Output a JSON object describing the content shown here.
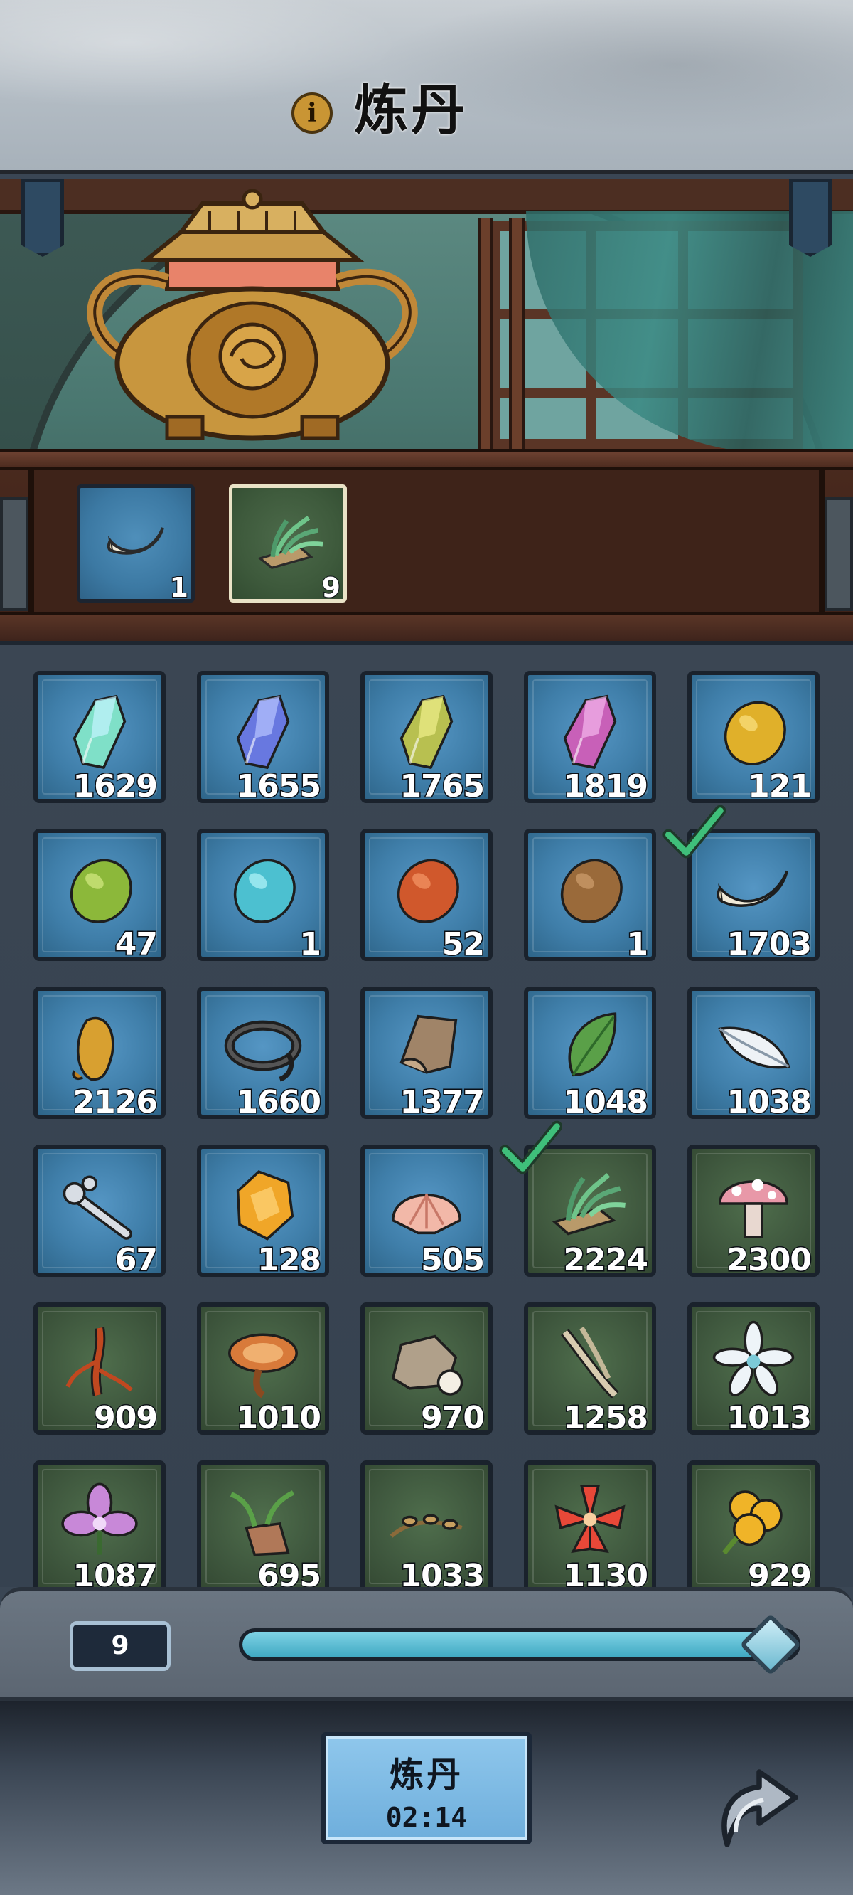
{
  "header": {
    "title": "炼丹",
    "info_icon": "info-icon"
  },
  "selected_slots": [
    {
      "item": "beast-tooth",
      "count": "1",
      "color": "blue",
      "selected": false
    },
    {
      "item": "spirit-grass",
      "count": "9",
      "color": "green",
      "selected": true
    }
  ],
  "inventory": [
    {
      "item": "cyan-crystal",
      "count": "1629",
      "color": "blue",
      "checked": false
    },
    {
      "item": "blue-crystal",
      "count": "1655",
      "color": "blue",
      "checked": false
    },
    {
      "item": "yellow-crystal",
      "count": "1765",
      "color": "blue",
      "checked": false
    },
    {
      "item": "pink-crystal",
      "count": "1819",
      "color": "blue",
      "checked": false
    },
    {
      "item": "gold-stone",
      "count": "121",
      "color": "blue",
      "checked": false
    },
    {
      "item": "green-stone",
      "count": "47",
      "color": "blue",
      "checked": false
    },
    {
      "item": "cyan-stone",
      "count": "1",
      "color": "blue",
      "checked": false
    },
    {
      "item": "red-stone",
      "count": "52",
      "color": "blue",
      "checked": false
    },
    {
      "item": "brown-stone",
      "count": "1",
      "color": "blue",
      "checked": false
    },
    {
      "item": "beast-tooth",
      "count": "1703",
      "color": "blue",
      "checked": true
    },
    {
      "item": "amber-claw",
      "count": "2126",
      "color": "blue",
      "checked": false
    },
    {
      "item": "black-ring",
      "count": "1660",
      "color": "blue",
      "checked": false
    },
    {
      "item": "hide-scrap",
      "count": "1377",
      "color": "blue",
      "checked": false
    },
    {
      "item": "green-leaf",
      "count": "1048",
      "color": "blue",
      "checked": false
    },
    {
      "item": "white-feather",
      "count": "1038",
      "color": "blue",
      "checked": false
    },
    {
      "item": "bone-staff",
      "count": "67",
      "color": "blue",
      "checked": false
    },
    {
      "item": "amber-shard",
      "count": "128",
      "color": "blue",
      "checked": false
    },
    {
      "item": "sea-shell",
      "count": "505",
      "color": "blue",
      "checked": false
    },
    {
      "item": "spirit-grass",
      "count": "2224",
      "color": "green",
      "checked": true
    },
    {
      "item": "spotted-mushroom",
      "count": "2300",
      "color": "green",
      "checked": false
    },
    {
      "item": "red-root",
      "count": "909",
      "color": "green",
      "checked": false
    },
    {
      "item": "lingzhi",
      "count": "1010",
      "color": "green",
      "checked": false
    },
    {
      "item": "rock-pearl",
      "count": "970",
      "color": "green",
      "checked": false
    },
    {
      "item": "pale-stalk",
      "count": "1258",
      "color": "green",
      "checked": false
    },
    {
      "item": "white-lotus",
      "count": "1013",
      "color": "green",
      "checked": false
    },
    {
      "item": "purple-flower",
      "count": "1087",
      "color": "green",
      "checked": false
    },
    {
      "item": "sprout-root",
      "count": "695",
      "color": "green",
      "checked": false
    },
    {
      "item": "seed-vine",
      "count": "1033",
      "color": "green",
      "checked": false
    },
    {
      "item": "red-lily",
      "count": "1130",
      "color": "green",
      "checked": false
    },
    {
      "item": "golden-flower",
      "count": "929",
      "color": "green",
      "checked": false
    }
  ],
  "slider": {
    "value": "9",
    "fill_fraction": 0.95
  },
  "brew_button": {
    "label": "炼丹",
    "timer": "02:14"
  },
  "back_button": {
    "icon": "curved-arrow-icon"
  },
  "colors": {
    "slot_blue": "#3f7ea9",
    "slot_green": "#40593f",
    "slider_fill": "#3fa8c2",
    "button_blue": "#7ab8e2",
    "check_green": "#3fbf7a"
  }
}
